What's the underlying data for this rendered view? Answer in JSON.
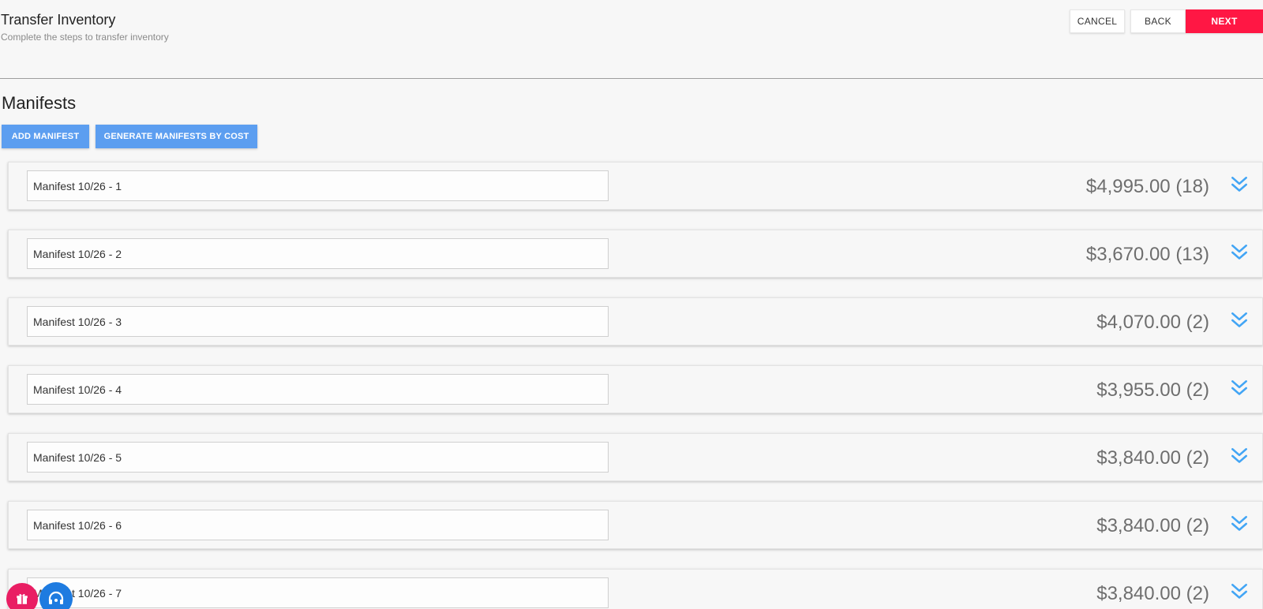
{
  "header": {
    "title": "Transfer Inventory",
    "subtitle": "Complete the steps to transfer inventory",
    "cancel_label": "CANCEL",
    "back_label": "BACK",
    "next_label": "NEXT"
  },
  "section": {
    "title": "Manifests",
    "add_label": "ADD MANIFEST",
    "generate_label": "GENERATE MANIFESTS BY COST"
  },
  "manifests": [
    {
      "name": "Manifest 10/26 - 1",
      "total": "$4,995.00 (18)"
    },
    {
      "name": "Manifest 10/26 - 2",
      "total": "$3,670.00 (13)"
    },
    {
      "name": "Manifest 10/26 - 3",
      "total": "$4,070.00 (2)"
    },
    {
      "name": "Manifest 10/26 - 4",
      "total": "$3,955.00 (2)"
    },
    {
      "name": "Manifest 10/26 - 5",
      "total": "$3,840.00 (2)"
    },
    {
      "name": "Manifest 10/26 - 6",
      "total": "$3,840.00 (2)"
    },
    {
      "name": "Manifest 10/26 - 7",
      "total": "$3,840.00 (2)"
    }
  ],
  "colors": {
    "accent": "#ff1744",
    "action_blue": "#5c9ef0",
    "chevron_blue": "#42a5f5"
  },
  "icons": {
    "expand": "chevron-double-down-icon",
    "fab_left": "gift-icon",
    "fab_right": "support-headset-icon"
  }
}
